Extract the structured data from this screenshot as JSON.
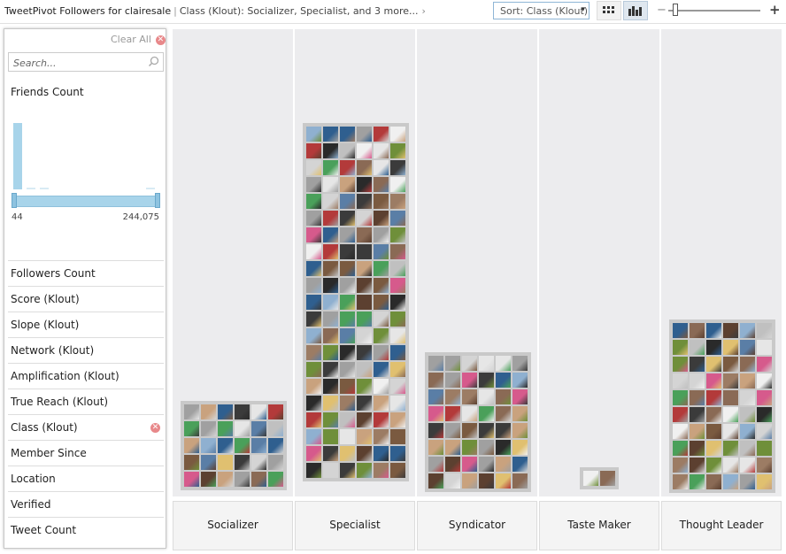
{
  "app": {
    "title": "TweetPivot Followers for clairesale",
    "breadcrumb_filter": "Class (Klout): Socializer, Specialist, and 3 more...",
    "chevron": "›"
  },
  "toolbar": {
    "sort_label": "Sort: Class (Klout)",
    "sort_caret": "▾",
    "zoom_minus": "−",
    "zoom_plus": "+",
    "view_modes": [
      "grid-view-icon",
      "graph-view-icon"
    ],
    "active_view": "graph"
  },
  "filter_panel": {
    "clear_all": "Clear All",
    "search_placeholder": "Search...",
    "friends_count": {
      "title": "Friends Count",
      "range_min": "44",
      "range_max": "244,075"
    },
    "facets": [
      {
        "label": "Followers Count",
        "active": false
      },
      {
        "label": "Score (Klout)",
        "active": false
      },
      {
        "label": "Slope (Klout)",
        "active": false
      },
      {
        "label": "Network (Klout)",
        "active": false
      },
      {
        "label": "Amplification (Klout)",
        "active": false
      },
      {
        "label": "True Reach (Klout)",
        "active": false
      },
      {
        "label": "Class (Klout)",
        "active": true
      },
      {
        "label": "Member Since",
        "active": false
      },
      {
        "label": "Location",
        "active": false
      },
      {
        "label": "Verified",
        "active": false
      },
      {
        "label": "Tweet Count",
        "active": false
      }
    ]
  },
  "columns": [
    {
      "label": "Socializer"
    },
    {
      "label": "Specialist"
    },
    {
      "label": "Syndicator"
    },
    {
      "label": "Taste Maker"
    },
    {
      "label": "Thought Leader"
    }
  ],
  "colors": {
    "accent": "#a8d4ea",
    "clear_icon": "#e8888a",
    "column_bg": "#ececee",
    "stack_bg": "#c9c9c9"
  }
}
